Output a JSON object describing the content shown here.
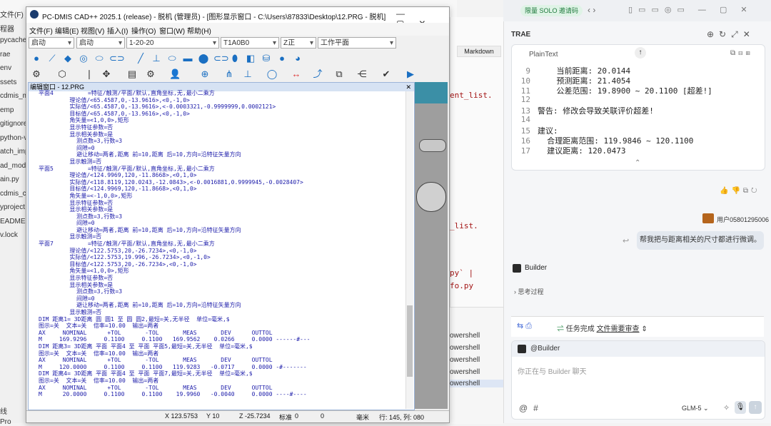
{
  "bg_tree": [
    "文件(F)",
    "程器",
    "pycache",
    "rae",
    "env",
    "ssets",
    "cdmis_m",
    "emp",
    "gitignore",
    "python-v",
    "atch_imp",
    "ad_mode",
    "ain.py",
    "cdmis_co",
    "yproject",
    "EADME.m",
    "v.lock",
    "线",
    "Pro"
  ],
  "bg_code": [
    "ent_list.",
    "_list.",
    "py` |",
    "fo.py"
  ],
  "terminal": {
    "items": [
      "owershell",
      "owershell",
      "owershell",
      "owershell",
      "owershell"
    ]
  },
  "markdown_tab": "Markdown",
  "trae": {
    "badge": "限量 SOLO 邀请码",
    "title": "TRAE",
    "code_lang": "PlainText",
    "code_lines": [
      {
        "n": "9",
        "t": "    当前距离: 20.0144"
      },
      {
        "n": "10",
        "t": "    预测距离: 21.4054"
      },
      {
        "n": "11",
        "t": "    公差范围: 19.8900 ~ 20.1100 [超差!]"
      },
      {
        "n": "12",
        "t": ""
      },
      {
        "n": "13",
        "t": "警告: 修改会导致关联评价超差!"
      },
      {
        "n": "14",
        "t": ""
      },
      {
        "n": "15",
        "t": "建议:"
      },
      {
        "n": "16",
        "t": "  合理距离范围: 119.9846 ~ 120.1100"
      },
      {
        "n": "17",
        "t": "  建议距离: 120.0473"
      }
    ],
    "user_name": "用户05801295006",
    "user_msg": "帮我把与距离相关的尺寸都进行微调。",
    "builder": "Builder",
    "thinking": "思考过程",
    "task_done": "任务完成",
    "task_files": "文件需要审查",
    "at_builder": "@Builder",
    "input_placeholder": "你正在与 Builder 聊天",
    "model": "GLM-5"
  },
  "pcdmis": {
    "title": "PC-DMIS CAD++ 2025.1 (release) - 脱机 (管理员) - [图形显示窗口 - C:\\Users\\87833\\Desktop\\12.PRG - 脱机]",
    "menus": [
      "文件(F)",
      "编辑(E)",
      "视图(V)",
      "插入(I)",
      "操作(O)",
      "窗口(W)",
      "帮助(H)"
    ],
    "combos": [
      "启动",
      "启动",
      "1-20-20",
      "T1A0B0",
      "Z正",
      "工作平面"
    ],
    "edit_title": "编辑窗口 - 12.PRG",
    "code": [
      "平面4          =特征/触测/平面/默认,直角坐标,无,最小二乘方",
      "         理论值/<65.4587,0,-13.9616>,<0,-1,0>",
      "         实际值/<65.4587,0,-13.9616>,<-0.0003321,-0.9999999,0.0002121>",
      "         目标值/<65.4587,0,-13.9616>,<0,-1,0>",
      "         角矢量=<1,0,0>,矩形",
      "         显示特征参数=否",
      "         显示相关参数=是",
      "           测点数=3,行数=3",
      "           间隙=0",
      "           避让移动=两者,距离 前=10,距离 后=10,方向=沿特征矢量方向",
      "         显示触测=否",
      "平面5          =特征/触测/平面/默认,直角坐标,无,最小二乘方",
      "         理论值/<124.9969,120,-11.8668>,<0,1,0>",
      "         实际值/<118.8119,120.0243,-12.0843>,<-0.0016881,0.9999945,-0.0028407>",
      "         目标值/<124.9969,120,-11.8668>,<0,1,0>",
      "         角矢量=<-1,0,0>,矩形",
      "         显示特征参数=否",
      "         显示相关参数=是",
      "           测点数=3,行数=3",
      "           间隙=0",
      "           避让移动=两者,距离 前=10,距离 后=10,方向=沿特征矢量方向",
      "         显示触测=否",
      "平面7          =特征/触测/平面/默认,直角坐标,无,最小二乘方",
      "         理论值/<122.5753,20,-26.7234>,<0,-1,0>",
      "         实际值/<122.5753,19.996,-26.7234>,<0,-1,0>",
      "         目标值/<122.5753,20,-26.7234>,<0,-1,0>",
      "         角矢量=<1,0,0>,矩形",
      "         显示特征参数=否",
      "         显示相关参数=是",
      "           测点数=3,行数=3",
      "           间隙=0",
      "           避让移动=两者,距离 前=10,距离 后=10,方向=沿特征矢量方向",
      "         显示触测=否",
      "DIM 距离1= 3D距离 圆 圆1 至 圆 圆2,最短=关,无半径  单位=毫米,$",
      "图示=关  文本=关  倍率=10.00  输出=两者",
      "AX     NOMINAL      +TOL       -TOL       MEAS       DEV      OUTTOL",
      "M     169.9296     0.1100     0.1100   169.9562    0.0266     0.0000 ------#---",
      "DIM 距离3= 3D距离 平面 平面4 至 平面 平面5,最短=关,无半径  单位=毫米,$",
      "图示=关  文本=关  倍率=10.00  输出=两者",
      "AX     NOMINAL      +TOL       -TOL       MEAS       DEV      OUTTOL",
      "M     120.0000     0.1100     0.1100   119.9283   -0.0717     0.0000 -#-------",
      "DIM 距离4= 3D距离 平面 平面4 至 平面 平面7,最短=关,无半径  单位=毫米,$",
      "图示=关  文本=关  倍率=10.00  输出=两者",
      "AX     NOMINAL      +TOL       -TOL       MEAS       DEV      OUTTOL",
      "M      20.0000     0.1100     0.1100    19.9960   -0.0040     0.0000 ----#----"
    ],
    "status": {
      "x": "X 123.5753",
      "y": "Y 10",
      "z": "Z -25.7234",
      "std": "标准",
      "zero": "0",
      "zero2": "0",
      "unit": "毫米",
      "pos": "行: 145, 列: 080"
    }
  }
}
